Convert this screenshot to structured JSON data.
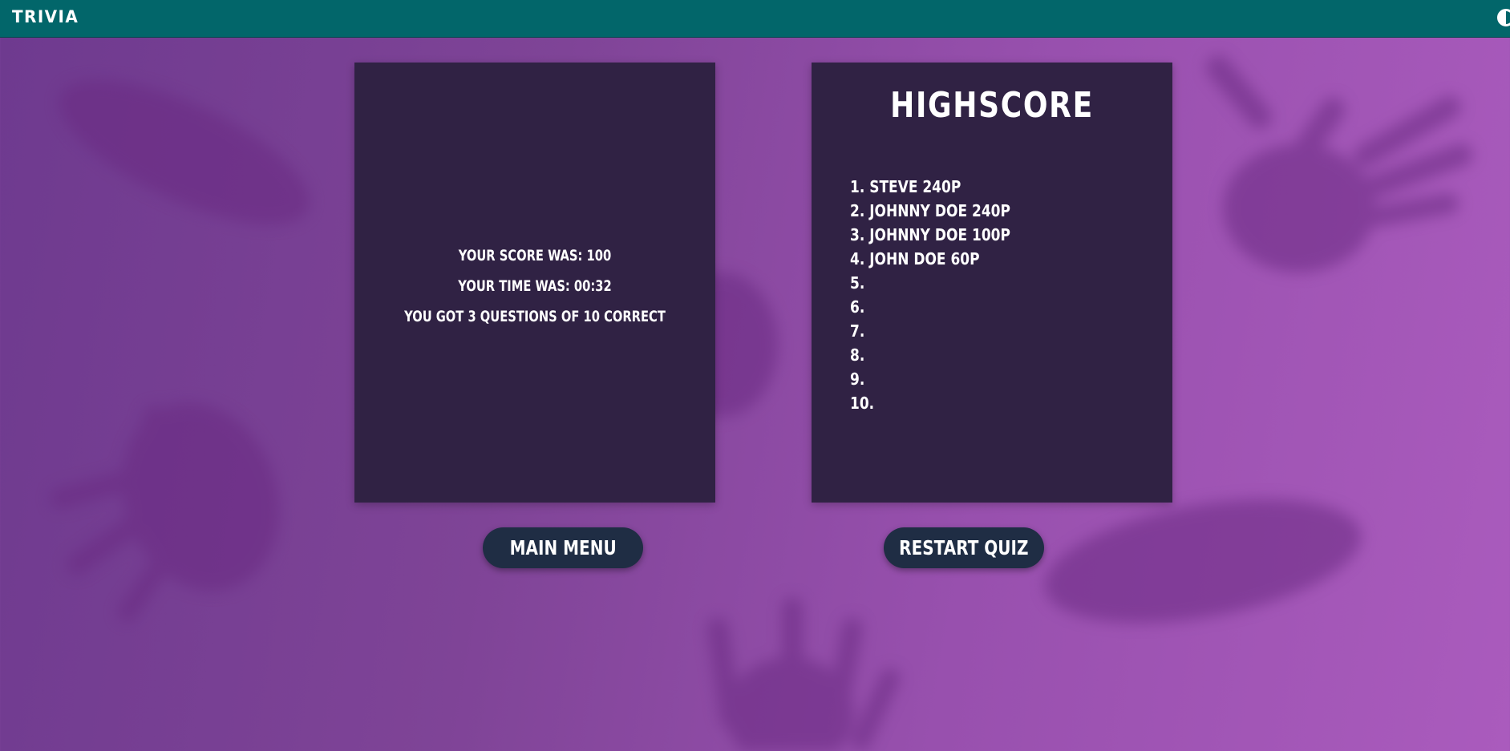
{
  "header": {
    "title": "TRIVIA",
    "theme_toggle_icon": "contrast-half-circle-icon"
  },
  "result": {
    "score_line": "YOUR SCORE WAS: 100",
    "time_line": "YOUR TIME WAS: 00:32",
    "correct_line": "YOU GOT 3 QUESTIONS OF 10 CORRECT"
  },
  "highscore": {
    "title": "HIGHSCORE",
    "entries": [
      "1. STEVE 240P",
      "2. JOHNNY DOE 240P",
      "3. JOHNNY DOE 100P",
      "4. JOHN DOE 60P",
      "5.",
      "6.",
      "7.",
      "8.",
      "9.",
      "10."
    ]
  },
  "buttons": {
    "main_menu": "MAIN MENU",
    "restart": "RESTART QUIZ"
  },
  "colors": {
    "topbar": "#02666a",
    "card": "#302244",
    "button": "#1f2d44",
    "background_start": "#6e3a8f",
    "background_end": "#aa5bbd"
  }
}
